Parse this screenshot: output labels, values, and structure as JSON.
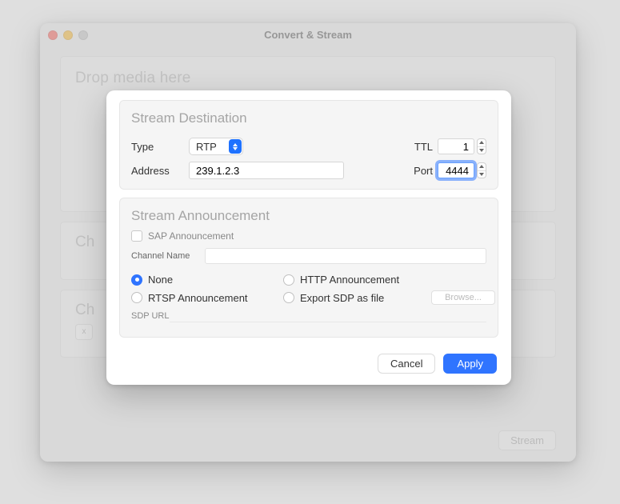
{
  "window": {
    "title": "Convert & Stream",
    "drop_label": "Drop media here",
    "row1_prefix": "Ch",
    "row2_prefix": "Ch",
    "tag_x": "x",
    "stream_btn": "Stream"
  },
  "sheet": {
    "dest": {
      "heading": "Stream Destination",
      "type_label": "Type",
      "type_value": "RTP",
      "ttl_label": "TTL",
      "ttl_value": "1",
      "address_label": "Address",
      "address_value": "239.1.2.3",
      "port_label": "Port",
      "port_value": "4444"
    },
    "ann": {
      "heading": "Stream Announcement",
      "sap_label": "SAP Announcement",
      "channel_label": "Channel Name",
      "radio_none": "None",
      "radio_http": "HTTP Announcement",
      "radio_rtsp": "RTSP Announcement",
      "radio_export": "Export SDP as file",
      "browse_label": "Browse...",
      "sdp_label": "SDP URL"
    },
    "buttons": {
      "cancel": "Cancel",
      "apply": "Apply"
    }
  }
}
